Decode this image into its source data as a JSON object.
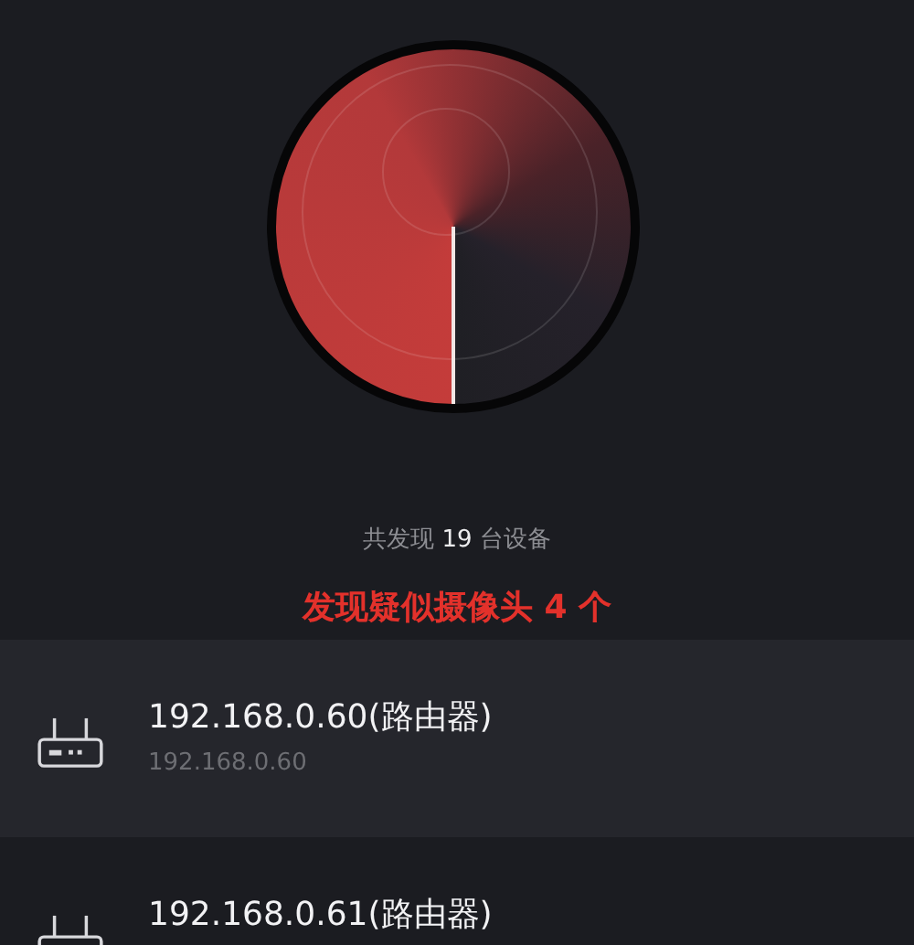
{
  "summary": "共发现 **19** 台设备",
  "alert": "发现疑似摄像头 4 个",
  "devices": [
    {
      "name": "192.168.0.60(路由器)",
      "ip": "192.168.0.60"
    },
    {
      "name": "192.168.0.61(路由器)"
    }
  ]
}
